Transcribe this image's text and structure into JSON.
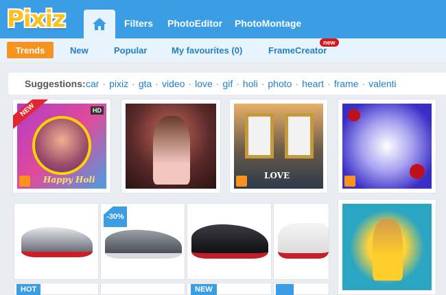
{
  "brand": {
    "logo_text": "Pixiz"
  },
  "topnav": {
    "home_icon": "home-icon",
    "links": [
      "Filters",
      "PhotoEditor",
      "PhotoMontage"
    ]
  },
  "subnav": {
    "active": "Trends",
    "links": [
      "New",
      "Popular",
      "My favourites (0)",
      "FrameCreator"
    ],
    "framecreator_badge": "new"
  },
  "suggestions": {
    "label": "Suggestions:",
    "items": [
      "car",
      "pixiz",
      "gta",
      "video",
      "love",
      "gif",
      "holi",
      "photo",
      "heart",
      "frame",
      "valenti"
    ]
  },
  "cards_row1": [
    {
      "ribbon": "NEW",
      "hd": "HD",
      "caption": "Happy Holi"
    },
    {
      "caption": ""
    },
    {
      "caption": "LOVE"
    },
    {
      "caption": ""
    }
  ],
  "shoes": [
    {
      "tag": ""
    },
    {
      "tag": "-30%"
    },
    {
      "tag": ""
    },
    {
      "tag": ""
    }
  ],
  "bottom_badges": [
    "HOT",
    "NEW"
  ],
  "colors": {
    "header": "#3b9ee5",
    "accent": "#f7931e",
    "link": "#1f7fc9",
    "logo": "#ffc21a"
  }
}
